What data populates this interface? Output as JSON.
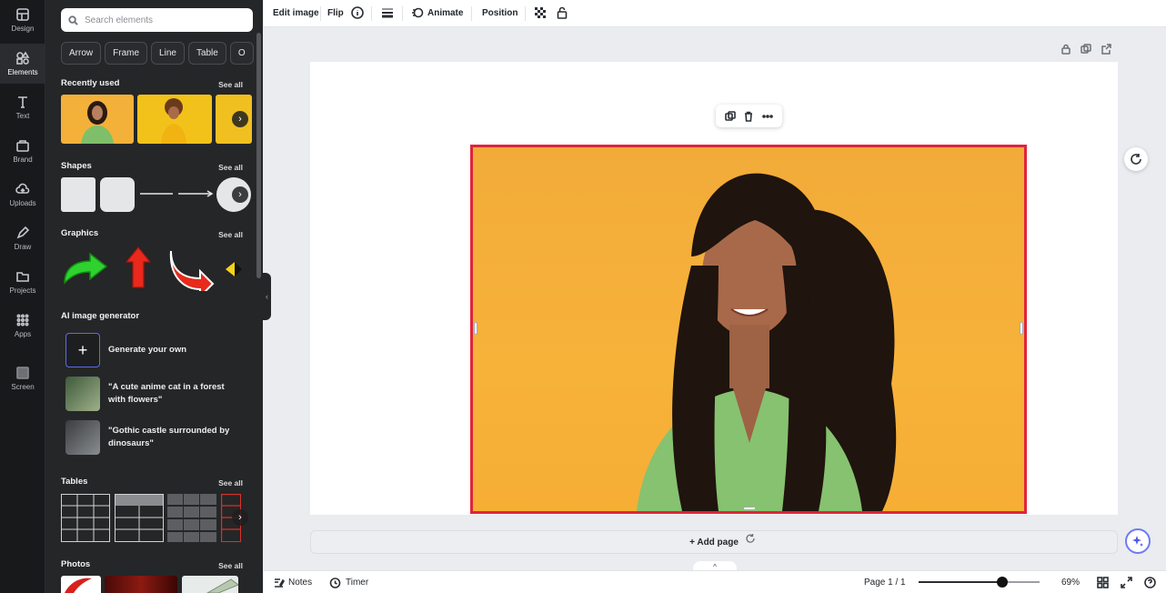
{
  "rail": {
    "items": [
      {
        "label": "Design",
        "icon": "design-icon"
      },
      {
        "label": "Elements",
        "icon": "elements-icon"
      },
      {
        "label": "Text",
        "icon": "text-icon"
      },
      {
        "label": "Brand",
        "icon": "brand-icon"
      },
      {
        "label": "Uploads",
        "icon": "uploads-icon"
      },
      {
        "label": "Draw",
        "icon": "draw-icon"
      },
      {
        "label": "Projects",
        "icon": "projects-icon"
      },
      {
        "label": "Apps",
        "icon": "apps-icon"
      },
      {
        "label": "Screen",
        "icon": "screen-icon"
      }
    ],
    "active": "Elements"
  },
  "panel": {
    "search_placeholder": "Search elements",
    "chips": [
      "Arrow",
      "Frame",
      "Line",
      "Table",
      "O"
    ],
    "see_all": "See all",
    "sections": {
      "recently_used": "Recently used",
      "shapes": "Shapes",
      "graphics": "Graphics",
      "ai_generator": "AI image generator",
      "tables": "Tables",
      "photos": "Photos"
    },
    "ai_items": [
      {
        "text": "Generate your own"
      },
      {
        "text": "\"A cute anime cat in a forest with flowers\""
      },
      {
        "text": "\"Gothic castle surrounded by dinosaurs\""
      }
    ]
  },
  "toolbar": {
    "edit_image": "Edit image",
    "flip": "Flip",
    "animate": "Animate",
    "position": "Position"
  },
  "canvas": {
    "add_page": "+ Add page"
  },
  "bottom": {
    "notes": "Notes",
    "timer": "Timer",
    "page_indicator": "Page 1 / 1",
    "zoom": "69%",
    "zoom_level": 0.69
  },
  "colors": {
    "accent_selection": "#e0243a",
    "photo_background": "#f6ad37",
    "magic_ring": "#6b7cf5"
  }
}
